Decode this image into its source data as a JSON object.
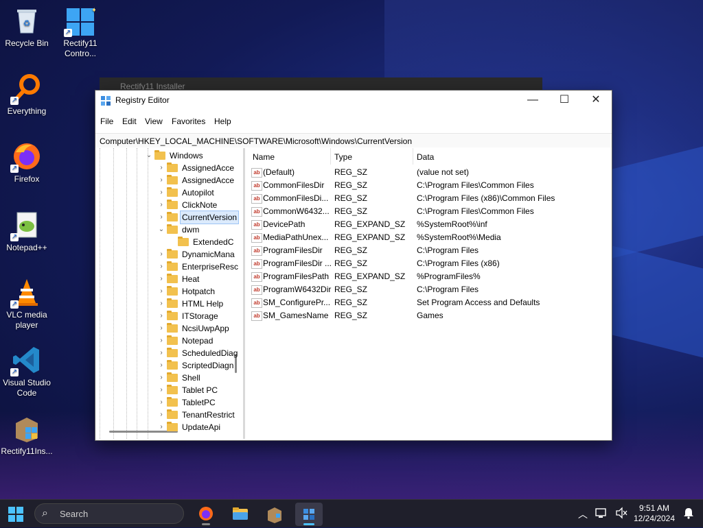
{
  "desktop": {
    "icons": [
      {
        "label": "Recycle Bin"
      },
      {
        "label": "Rectify11 Contro..."
      },
      {
        "label": "Everything"
      },
      {
        "label": "Firefox"
      },
      {
        "label": "Notepad++"
      },
      {
        "label": "VLC media player"
      },
      {
        "label": "Visual Studio Code"
      },
      {
        "label": "Rectify11Ins..."
      }
    ],
    "background_window_title": "Rectify11 Installer"
  },
  "window": {
    "title": "Registry Editor",
    "controls": {
      "minimize": "—",
      "maximize": "☐",
      "close": "✕"
    },
    "menu": [
      "File",
      "Edit",
      "View",
      "Favorites",
      "Help"
    ],
    "address": "Computer\\HKEY_LOCAL_MACHINE\\SOFTWARE\\Microsoft\\Windows\\CurrentVersion",
    "tree": [
      {
        "label": "Windows",
        "expanded": true
      },
      {
        "label": "AssignedAcce"
      },
      {
        "label": "AssignedAcce"
      },
      {
        "label": "Autopilot"
      },
      {
        "label": "ClickNote"
      },
      {
        "label": "CurrentVersion",
        "selected": true
      },
      {
        "label": "dwm",
        "expanded": true
      },
      {
        "label": "ExtendedC"
      },
      {
        "label": "DynamicMana"
      },
      {
        "label": "EnterpriseResc"
      },
      {
        "label": "Heat"
      },
      {
        "label": "Hotpatch"
      },
      {
        "label": "HTML Help"
      },
      {
        "label": "ITStorage"
      },
      {
        "label": "NcsiUwpApp"
      },
      {
        "label": "Notepad"
      },
      {
        "label": "ScheduledDiag"
      },
      {
        "label": "ScriptedDiagn"
      },
      {
        "label": "Shell"
      },
      {
        "label": "Tablet PC"
      },
      {
        "label": "TabletPC"
      },
      {
        "label": "TenantRestrict"
      },
      {
        "label": "UpdateApi"
      }
    ],
    "columns": [
      "Name",
      "Type",
      "Data"
    ],
    "values": [
      {
        "name": "(Default)",
        "type": "REG_SZ",
        "data": "(value not set)"
      },
      {
        "name": "CommonFilesDir",
        "type": "REG_SZ",
        "data": "C:\\Program Files\\Common Files"
      },
      {
        "name": "CommonFilesDi...",
        "type": "REG_SZ",
        "data": "C:\\Program Files (x86)\\Common Files"
      },
      {
        "name": "CommonW6432...",
        "type": "REG_SZ",
        "data": "C:\\Program Files\\Common Files"
      },
      {
        "name": "DevicePath",
        "type": "REG_EXPAND_SZ",
        "data": "%SystemRoot%\\inf"
      },
      {
        "name": "MediaPathUnex...",
        "type": "REG_EXPAND_SZ",
        "data": "%SystemRoot%\\Media"
      },
      {
        "name": "ProgramFilesDir",
        "type": "REG_SZ",
        "data": "C:\\Program Files"
      },
      {
        "name": "ProgramFilesDir ...",
        "type": "REG_SZ",
        "data": "C:\\Program Files (x86)"
      },
      {
        "name": "ProgramFilesPath",
        "type": "REG_EXPAND_SZ",
        "data": "%ProgramFiles%"
      },
      {
        "name": "ProgramW6432Dir",
        "type": "REG_SZ",
        "data": "C:\\Program Files"
      },
      {
        "name": "SM_ConfigurePr...",
        "type": "REG_SZ",
        "data": "Set Program Access and Defaults"
      },
      {
        "name": "SM_GamesName",
        "type": "REG_SZ",
        "data": "Games"
      }
    ],
    "value_icon_text": "ab"
  },
  "taskbar": {
    "search_placeholder": "Search",
    "clock_time": "9:51 AM",
    "clock_date": "12/24/2024",
    "accent": "#4cc2ff"
  }
}
